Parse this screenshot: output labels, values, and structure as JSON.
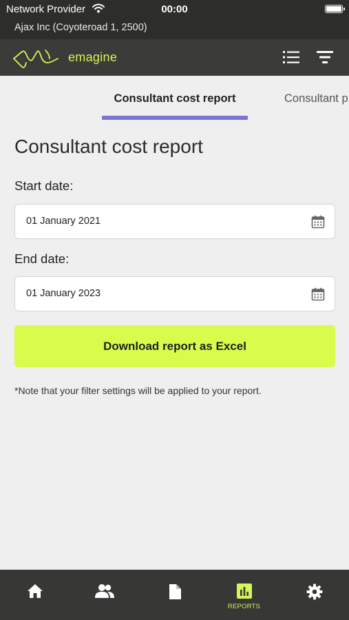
{
  "status_bar": {
    "carrier": "Network Provider",
    "time": "00:00",
    "wifi_icon": "wifi-icon",
    "battery_icon": "battery-icon"
  },
  "company_line": "Ajax Inc (Coyoteroad 1, 2500)",
  "app_bar": {
    "logo_text": "emagine",
    "logo_icon": "emagine-logo-icon",
    "list_icon": "list-icon",
    "filter_icon": "filter-icon",
    "accent_color": "#d5f55a"
  },
  "tabs": [
    {
      "label": "Consultant cost report",
      "active": true
    },
    {
      "label": "Consultant p",
      "active": false
    }
  ],
  "tab_indicator_color": "#7a74d3",
  "page_title": "Consultant cost report",
  "start_date": {
    "label": "Start date:",
    "value": "01 January 2021",
    "icon": "calendar-icon"
  },
  "end_date": {
    "label": "End date:",
    "value": "01 January 2023",
    "icon": "calendar-icon"
  },
  "download_button": {
    "label": "Download report as Excel",
    "color": "#d8fb4c"
  },
  "note": "*Note that your filter settings will be applied to your report.",
  "bottom_nav": [
    {
      "icon": "home-icon",
      "label": "",
      "active": false
    },
    {
      "icon": "people-icon",
      "label": "",
      "active": false
    },
    {
      "icon": "document-icon",
      "label": "",
      "active": false
    },
    {
      "icon": "bar-chart-icon",
      "label": "REPORTS",
      "active": true
    },
    {
      "icon": "gear-icon",
      "label": "",
      "active": false
    }
  ]
}
